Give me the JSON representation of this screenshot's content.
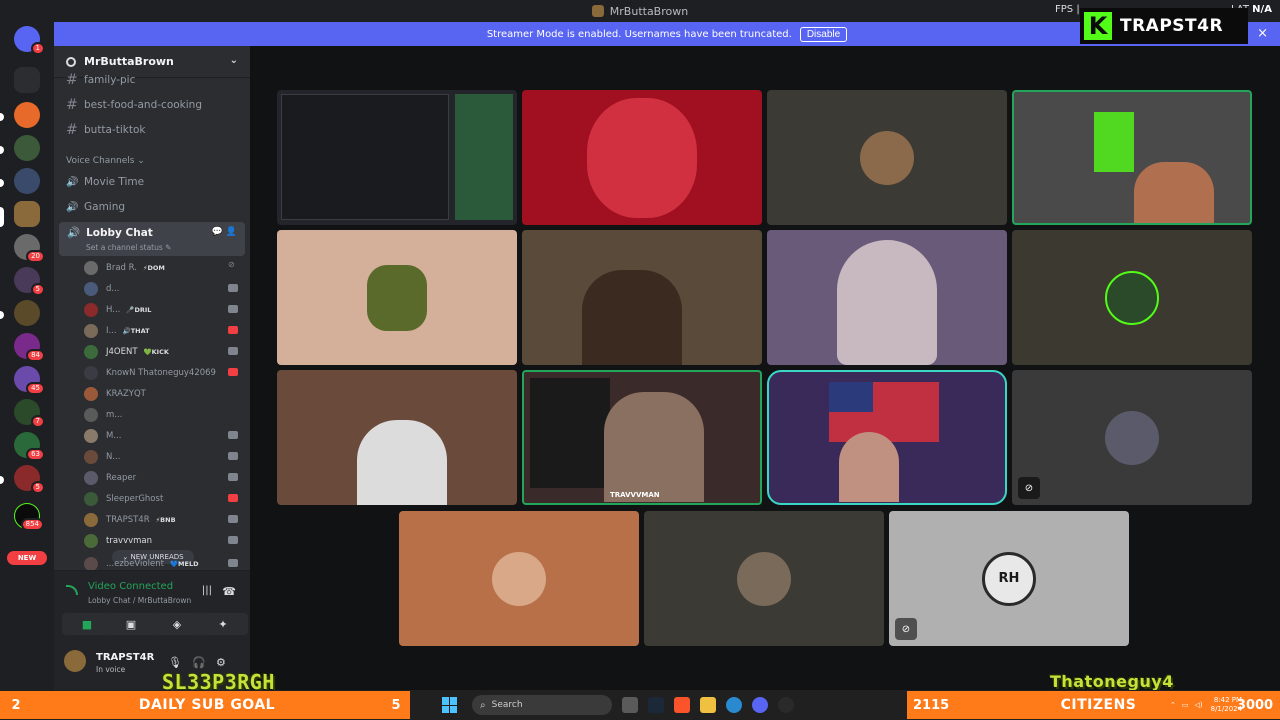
{
  "window": {
    "title": "MrButtaBrown",
    "fps_label": "FPS",
    "lat_label": "LAT",
    "lat_value": "N/A"
  },
  "banner": {
    "text": "Streamer Mode is enabled. Usernames have been truncated.",
    "disable_label": "Disable",
    "close_icon": "×"
  },
  "kick_overlay": {
    "logo_letter": "K",
    "channel": "TRAPST4R",
    "brand_color": "#53fc18"
  },
  "server_rail": {
    "badges": [
      "1",
      "20",
      "5",
      "84",
      "45",
      "7",
      "63",
      "5",
      "854"
    ],
    "new_label": "NEW"
  },
  "server": {
    "name": "MrButtaBrown",
    "chevron": "⌄"
  },
  "text_channels": [
    {
      "name": "family-pic"
    },
    {
      "name": "best-food-and-cooking"
    },
    {
      "name": "butta-tiktok"
    }
  ],
  "voice_section_title": "Voice Channels ⌄",
  "voice_channels": [
    {
      "name": "Movie Time"
    },
    {
      "name": "Gaming"
    }
  ],
  "lobby": {
    "name": "Lobby Chat",
    "status": "Set a channel status ✎",
    "users": [
      {
        "name": "Brad R.",
        "tag": "⚡DOM"
      },
      {
        "name": "d...",
        "tag": ""
      },
      {
        "name": "H...",
        "tag": "🎤DRIL"
      },
      {
        "name": "I...",
        "tag": "🔊THAT"
      },
      {
        "name": "J4OENT",
        "tag": "💚KICK"
      },
      {
        "name": "KnowN Thatoneguy42069",
        "tag": ""
      },
      {
        "name": "KRAZYQT",
        "tag": ""
      },
      {
        "name": "m...",
        "tag": ""
      },
      {
        "name": "M...",
        "tag": ""
      },
      {
        "name": "N...",
        "tag": ""
      },
      {
        "name": "Reaper",
        "tag": ""
      },
      {
        "name": "SleeperGhost",
        "tag": ""
      },
      {
        "name": "TRAPST4R",
        "tag": "⚡BNB"
      },
      {
        "name": "travvvman",
        "tag": ""
      },
      {
        "name": "...ezbeViolent",
        "tag": "💙MELD"
      }
    ],
    "new_unreads": "⌄ NEW UNREADS"
  },
  "voice_panel": {
    "status": "Video Connected",
    "location": "Lobby Chat / MrButtaBrown"
  },
  "user_panel": {
    "name": "TRAPST4R",
    "status": "In voice"
  },
  "video_tiles": [
    {
      "label": "screenshare-1"
    },
    {
      "label": "cam-2"
    },
    {
      "label": "avatar-3"
    },
    {
      "label": "cam-4"
    },
    {
      "label": "avatar-5"
    },
    {
      "label": "cam-6"
    },
    {
      "label": "cam-7"
    },
    {
      "label": "avatar-8"
    },
    {
      "label": "cam-9"
    },
    {
      "label": "cam-10",
      "nametag": "TRAVVVMAN"
    },
    {
      "label": "cam-11"
    },
    {
      "label": "avatar-12"
    },
    {
      "label": "avatar-13"
    },
    {
      "label": "avatar-14"
    },
    {
      "label": "avatar-15",
      "monogram": "RH"
    }
  ],
  "overlays": {
    "left_name": "SL33P3RGH",
    "right_name": "Thatoneguy4"
  },
  "bottom_bar": {
    "goal_left": "2",
    "goal_title": "DAILY SUB GOAL",
    "goal_right": "5",
    "citizens_count": "2115",
    "citizens_title": "CITIZENS",
    "citizens_right": "3000"
  },
  "taskbar": {
    "search_placeholder": "Search",
    "time": "8:42 PM",
    "date": "8/1/2024"
  }
}
